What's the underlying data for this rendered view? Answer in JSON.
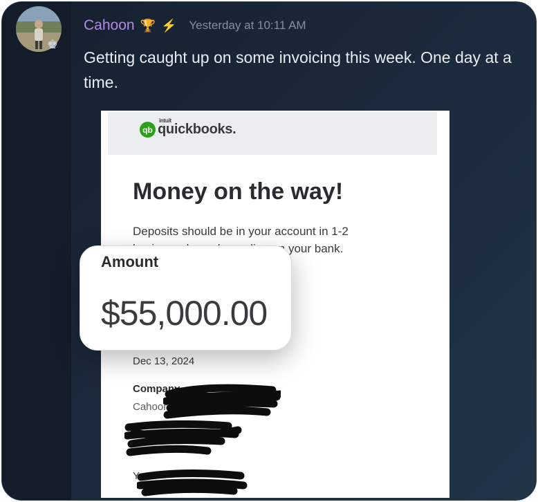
{
  "post": {
    "username": "Cahoon",
    "badges": [
      {
        "icon": "trophy-icon",
        "glyph": "🏆"
      },
      {
        "icon": "lightning-icon",
        "glyph": "⚡"
      }
    ],
    "timestamp": "Yesterday at 10:11 AM",
    "message": "Getting caught up on some invoicing this week. One day at a time."
  },
  "screenshot": {
    "brand": "quickbooks.",
    "brand_parent": "intuit",
    "brand_badge": "qb",
    "title": "Money on the way!",
    "description": "Deposits should be in your account in 1-2 business days, depending on your bank.",
    "date": "Dec 13, 2024",
    "company_label": "Company",
    "company_value": "Cahoon",
    "truncated_label": "Y"
  },
  "amount_callout": {
    "label": "Amount",
    "value": "$55,000.00"
  },
  "colors": {
    "username": "#b08be0",
    "quickbooks_green": "#2ca01c",
    "background": "#1b2a3c"
  }
}
